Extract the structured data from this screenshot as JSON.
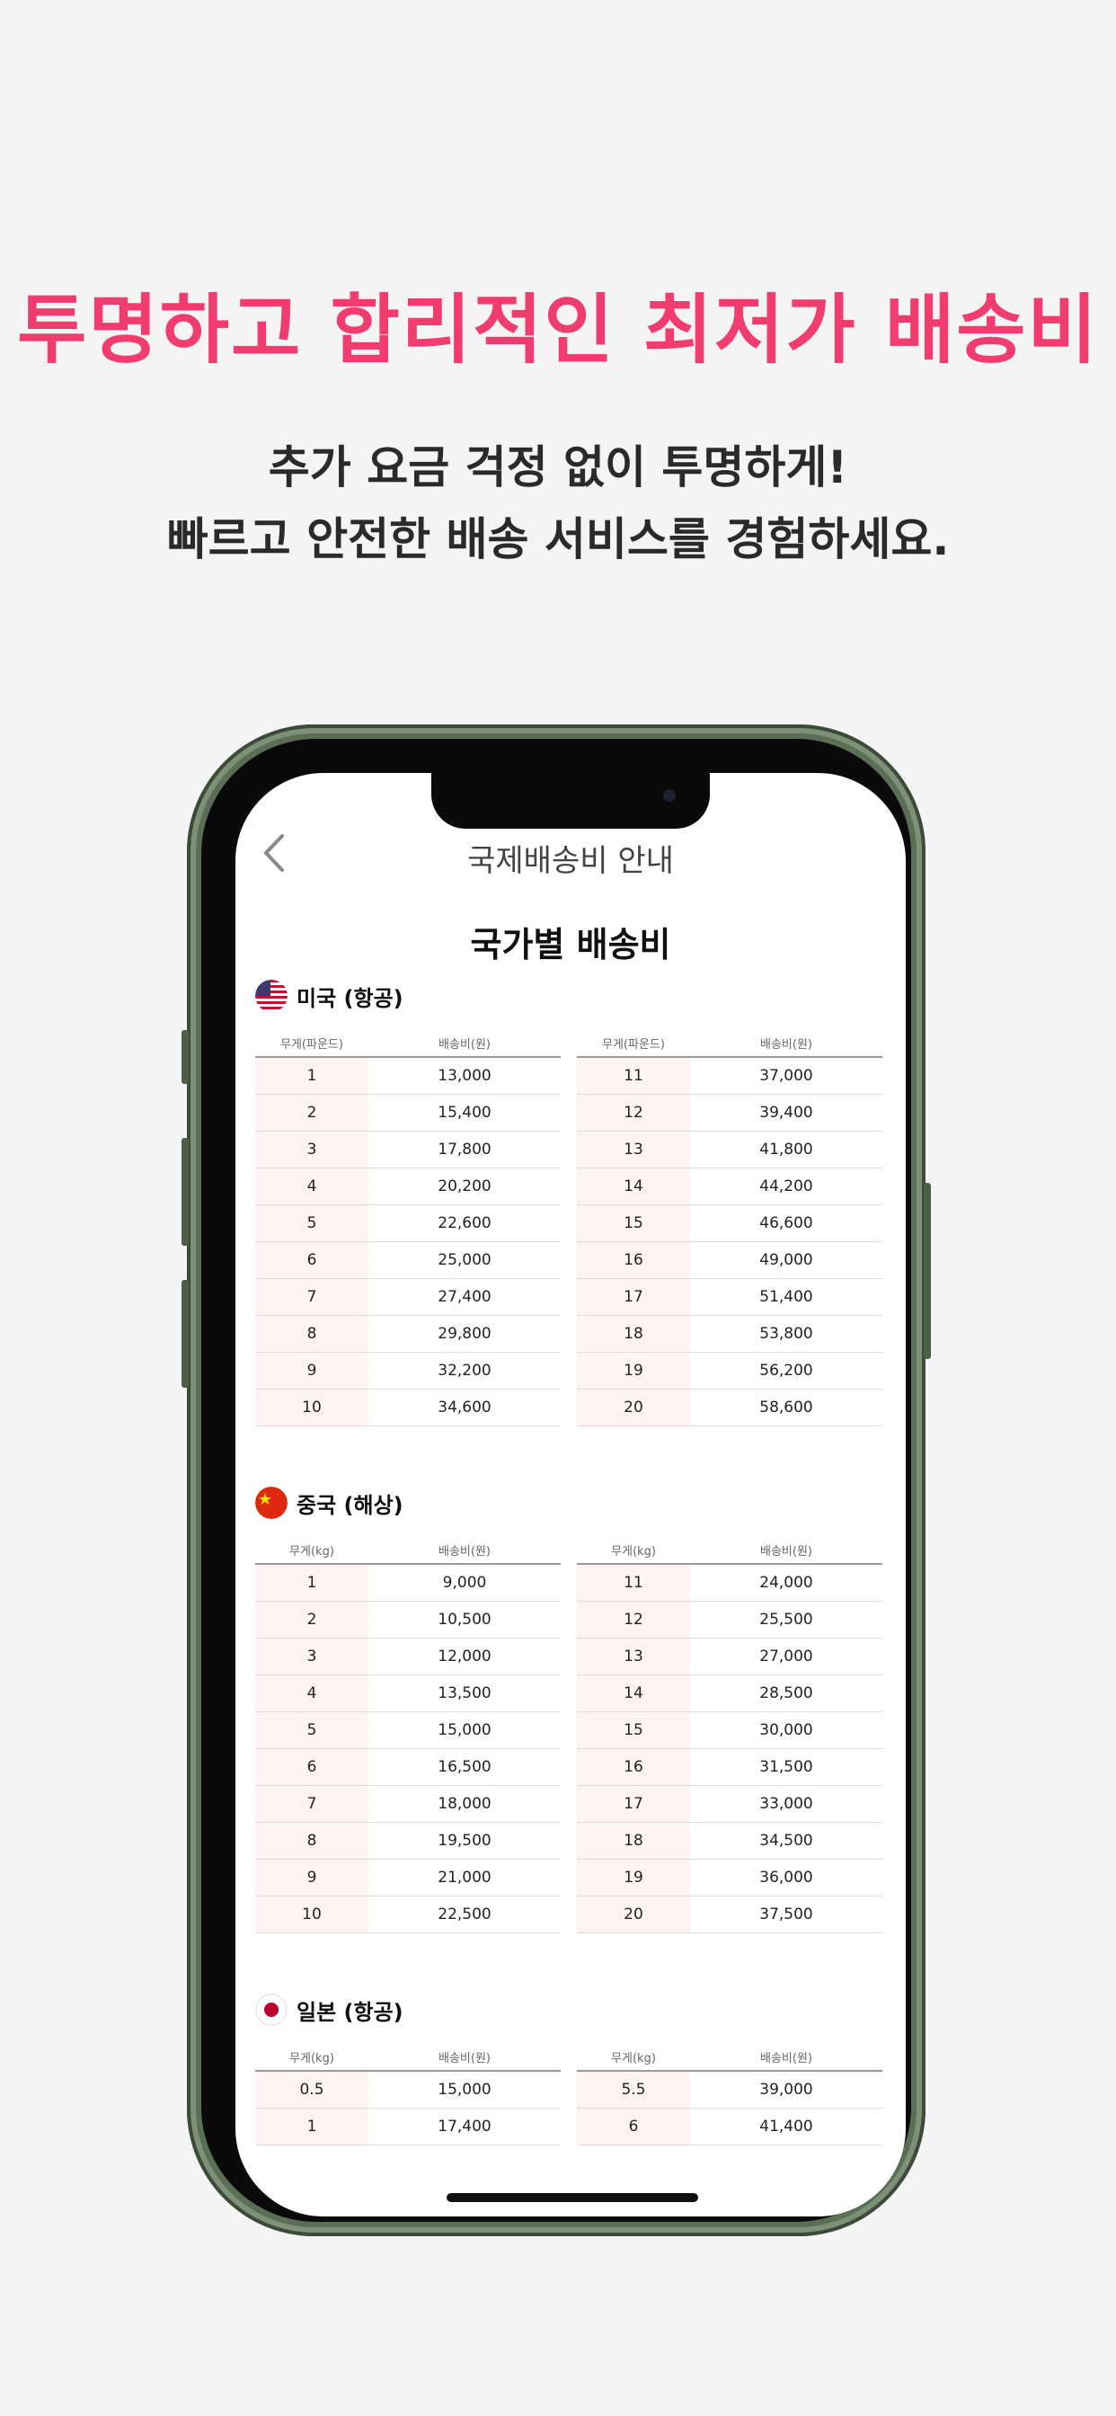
{
  "headline": "투명하고 합리적인 최저가 배송비",
  "subline1": "추가 요금 걱정 없이 투명하게!",
  "subline2": "빠르고 안전한 배송 서비스를 경험하세요.",
  "screen": {
    "nav_title": "국제배송비 안내",
    "page_title": "국가별 배송비",
    "sections": [
      {
        "title": "미국 (항공)",
        "flag": "us-flag-icon",
        "col_weight": "무게(파운드)",
        "col_price": "배송비(원)",
        "left_rows": [
          [
            "1",
            "13,000"
          ],
          [
            "2",
            "15,400"
          ],
          [
            "3",
            "17,800"
          ],
          [
            "4",
            "20,200"
          ],
          [
            "5",
            "22,600"
          ],
          [
            "6",
            "25,000"
          ],
          [
            "7",
            "27,400"
          ],
          [
            "8",
            "29,800"
          ],
          [
            "9",
            "32,200"
          ],
          [
            "10",
            "34,600"
          ]
        ],
        "right_rows": [
          [
            "11",
            "37,000"
          ],
          [
            "12",
            "39,400"
          ],
          [
            "13",
            "41,800"
          ],
          [
            "14",
            "44,200"
          ],
          [
            "15",
            "46,600"
          ],
          [
            "16",
            "49,000"
          ],
          [
            "17",
            "51,400"
          ],
          [
            "18",
            "53,800"
          ],
          [
            "19",
            "56,200"
          ],
          [
            "20",
            "58,600"
          ]
        ]
      },
      {
        "title": "중국 (해상)",
        "flag": "china-flag-icon",
        "col_weight": "무게(kg)",
        "col_price": "배송비(원)",
        "left_rows": [
          [
            "1",
            "9,000"
          ],
          [
            "2",
            "10,500"
          ],
          [
            "3",
            "12,000"
          ],
          [
            "4",
            "13,500"
          ],
          [
            "5",
            "15,000"
          ],
          [
            "6",
            "16,500"
          ],
          [
            "7",
            "18,000"
          ],
          [
            "8",
            "19,500"
          ],
          [
            "9",
            "21,000"
          ],
          [
            "10",
            "22,500"
          ]
        ],
        "right_rows": [
          [
            "11",
            "24,000"
          ],
          [
            "12",
            "25,500"
          ],
          [
            "13",
            "27,000"
          ],
          [
            "14",
            "28,500"
          ],
          [
            "15",
            "30,000"
          ],
          [
            "16",
            "31,500"
          ],
          [
            "17",
            "33,000"
          ],
          [
            "18",
            "34,500"
          ],
          [
            "19",
            "36,000"
          ],
          [
            "20",
            "37,500"
          ]
        ]
      },
      {
        "title": "일본 (항공)",
        "flag": "japan-flag-icon",
        "col_weight": "무게(kg)",
        "col_price": "배송비(원)",
        "left_rows": [
          [
            "0.5",
            "15,000"
          ],
          [
            "1",
            "17,400"
          ]
        ],
        "right_rows": [
          [
            "5.5",
            "39,000"
          ],
          [
            "6",
            "41,400"
          ]
        ]
      }
    ]
  }
}
